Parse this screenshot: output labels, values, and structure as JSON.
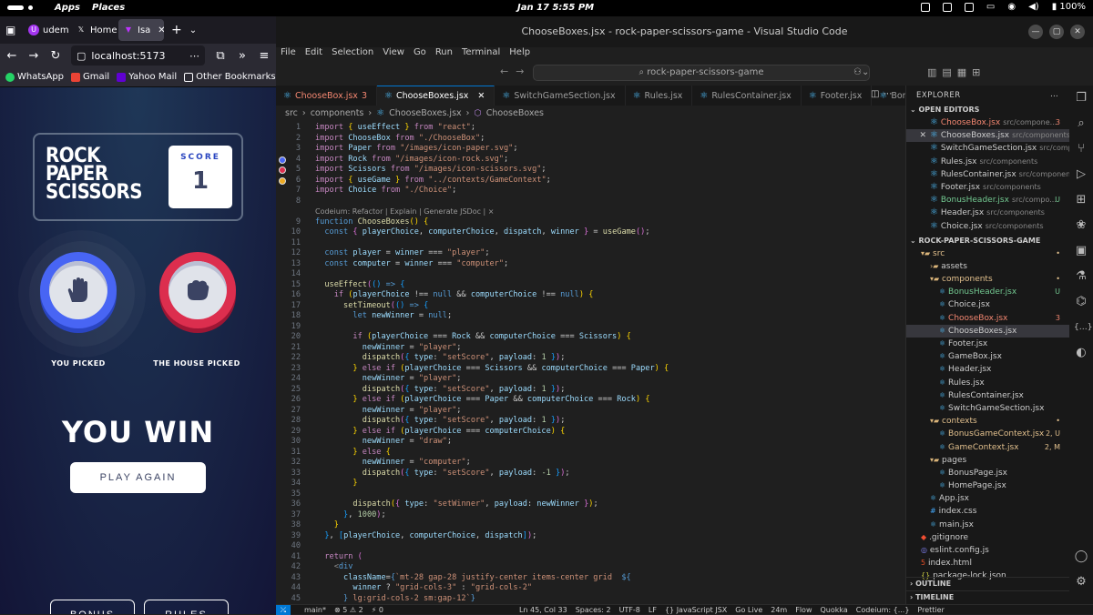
{
  "topbar": {
    "apps": "Apps",
    "places": "Places",
    "clock": "Jan 17  5:55 PM",
    "battery": "100%"
  },
  "browser": {
    "tabs": [
      {
        "label": "udem",
        "icon": "udemy-icon"
      },
      {
        "label": "Home",
        "icon": "x-icon"
      },
      {
        "label": "Isa",
        "icon": "vite-icon"
      }
    ],
    "url": "localhost:5173",
    "bookmarks": [
      "WhatsApp",
      "Gmail",
      "Yahoo Mail",
      "Other Bookmarks"
    ]
  },
  "game": {
    "title_l1": "ROCK",
    "title_l2": "PAPER",
    "title_l3": "SCISSORS",
    "score_label": "SCORE",
    "score_value": "1",
    "you_picked": "YOU PICKED",
    "house_picked": "THE HOUSE PICKED",
    "result": "YOU WIN",
    "play_again": "PLAY AGAIN",
    "bonus": "BONUS",
    "rules": "RULES",
    "colors": {
      "paper": "#4865f4",
      "rock": "#dc2e4e"
    }
  },
  "vscode": {
    "title": "ChooseBoxes.jsx - rock-paper-scissors-game - Visual Studio Code",
    "menu": [
      "File",
      "Edit",
      "Selection",
      "View",
      "Go",
      "Run",
      "Terminal",
      "Help"
    ],
    "search": "rock-paper-scissors-game",
    "tabs": [
      {
        "label": "ChooseBox.jsx",
        "badge": "3"
      },
      {
        "label": "ChooseBoxes.jsx",
        "badge": ""
      },
      {
        "label": "SwitchGameSection.jsx",
        "badge": ""
      },
      {
        "label": "Rules.jsx",
        "badge": ""
      },
      {
        "label": "RulesContainer.jsx",
        "badge": ""
      },
      {
        "label": "Footer.jsx",
        "badge": ""
      },
      {
        "label": "Bonus",
        "badge": ""
      }
    ],
    "breadcrumb": [
      "src",
      "components",
      "ChooseBoxes.jsx",
      "ChooseBoxes"
    ],
    "codelens": "Codeium: Refactor | Explain | Generate JSDoc | ×",
    "explorer": {
      "header": "EXPLORER",
      "open_editors_label": "OPEN EDITORS",
      "project_label": "ROCK-PAPER-SCISSORS-GAME",
      "outline": "OUTLINE",
      "timeline": "TIMELINE",
      "open_editors": [
        {
          "name": "ChooseBox.jsx",
          "path": "src/compone...",
          "status": "3",
          "cls": "err"
        },
        {
          "name": "ChooseBoxes.jsx",
          "path": "src/components",
          "status": "",
          "cls": ""
        },
        {
          "name": "SwitchGameSection.jsx",
          "path": "src/comp...",
          "status": "",
          "cls": ""
        },
        {
          "name": "Rules.jsx",
          "path": "src/components",
          "status": "",
          "cls": ""
        },
        {
          "name": "RulesContainer.jsx",
          "path": "src/components",
          "status": "",
          "cls": ""
        },
        {
          "name": "Footer.jsx",
          "path": "src/components",
          "status": "",
          "cls": ""
        },
        {
          "name": "BonusHeader.jsx",
          "path": "src/compo...",
          "status": "U",
          "cls": "unt"
        },
        {
          "name": "Header.jsx",
          "path": "src/components",
          "status": "",
          "cls": ""
        },
        {
          "name": "Choice.jsx",
          "path": "src/components",
          "status": "",
          "cls": ""
        }
      ],
      "tree": [
        {
          "name": "src",
          "indent": 1,
          "kind": "folder",
          "status": "•",
          "cls": "mod"
        },
        {
          "name": "assets",
          "indent": 2,
          "kind": "folder-closed",
          "status": "",
          "cls": ""
        },
        {
          "name": "components",
          "indent": 2,
          "kind": "folder",
          "status": "•",
          "cls": "mod"
        },
        {
          "name": "BonusHeader.jsx",
          "indent": 3,
          "kind": "react",
          "status": "U",
          "cls": "unt"
        },
        {
          "name": "Choice.jsx",
          "indent": 3,
          "kind": "react",
          "status": "",
          "cls": ""
        },
        {
          "name": "ChooseBox.jsx",
          "indent": 3,
          "kind": "react",
          "status": "3",
          "cls": "err"
        },
        {
          "name": "ChooseBoxes.jsx",
          "indent": 3,
          "kind": "react",
          "status": "",
          "cls": "",
          "sel": true
        },
        {
          "name": "Footer.jsx",
          "indent": 3,
          "kind": "react",
          "status": "",
          "cls": ""
        },
        {
          "name": "GameBox.jsx",
          "indent": 3,
          "kind": "react",
          "status": "",
          "cls": ""
        },
        {
          "name": "Header.jsx",
          "indent": 3,
          "kind": "react",
          "status": "",
          "cls": ""
        },
        {
          "name": "Rules.jsx",
          "indent": 3,
          "kind": "react",
          "status": "",
          "cls": ""
        },
        {
          "name": "RulesContainer.jsx",
          "indent": 3,
          "kind": "react",
          "status": "",
          "cls": ""
        },
        {
          "name": "SwitchGameSection.jsx",
          "indent": 3,
          "kind": "react",
          "status": "",
          "cls": ""
        },
        {
          "name": "contexts",
          "indent": 2,
          "kind": "folder",
          "status": "•",
          "cls": "mod"
        },
        {
          "name": "BonusGameContext.jsx",
          "indent": 3,
          "kind": "react",
          "status": "2, U",
          "cls": "mod"
        },
        {
          "name": "GameContext.jsx",
          "indent": 3,
          "kind": "react",
          "status": "2, M",
          "cls": "mod"
        },
        {
          "name": "pages",
          "indent": 2,
          "kind": "folder",
          "status": "",
          "cls": ""
        },
        {
          "name": "BonusPage.jsx",
          "indent": 3,
          "kind": "react",
          "status": "",
          "cls": ""
        },
        {
          "name": "HomePage.jsx",
          "indent": 3,
          "kind": "react",
          "status": "",
          "cls": ""
        },
        {
          "name": "App.jsx",
          "indent": 2,
          "kind": "react",
          "status": "",
          "cls": ""
        },
        {
          "name": "index.css",
          "indent": 2,
          "kind": "css",
          "status": "",
          "cls": ""
        },
        {
          "name": "main.jsx",
          "indent": 2,
          "kind": "react",
          "status": "",
          "cls": ""
        },
        {
          "name": ".gitignore",
          "indent": 1,
          "kind": "git",
          "status": "",
          "cls": ""
        },
        {
          "name": "eslint.config.js",
          "indent": 1,
          "kind": "eslint",
          "status": "",
          "cls": ""
        },
        {
          "name": "index.html",
          "indent": 1,
          "kind": "html",
          "status": "",
          "cls": ""
        },
        {
          "name": "package-lock.json",
          "indent": 1,
          "kind": "json",
          "status": "",
          "cls": ""
        }
      ]
    },
    "code": [
      {
        "n": "1",
        "h": "<span class='k'>import</span> <span class='y'>{</span> <span class='v'>useEffect</span> <span class='y'>}</span> <span class='k'>from</span> <span class='s'>\"react\"</span>;"
      },
      {
        "n": "2",
        "h": "<span class='k'>import</span> <span class='v'>ChooseBox</span> <span class='k'>from</span> <span class='s'>\"./ChooseBox\"</span>;"
      },
      {
        "n": "3",
        "h": "<span class='k'>import</span> <span class='v'>Paper</span> <span class='k'>from</span> <span class='s'>\"/images/icon-paper.svg\"</span>;"
      },
      {
        "n": "4",
        "h": "<span class='k'>import</span> <span class='v'>Rock</span> <span class='k'>from</span> <span class='s'>\"/images/icon-rock.svg\"</span>;"
      },
      {
        "n": "5",
        "h": "<span class='k'>import</span> <span class='v'>Scissors</span> <span class='k'>from</span> <span class='s'>\"/images/icon-scissors.svg\"</span>;"
      },
      {
        "n": "6",
        "h": "<span class='k'>import</span> <span class='y'>{</span> <span class='v'>useGame</span> <span class='y'>}</span> <span class='k'>from</span> <span class='s'>\"../contexts/GameContext\"</span>;"
      },
      {
        "n": "7",
        "h": "<span class='k'>import</span> <span class='v'>Choice</span> <span class='k'>from</span> <span class='s'>\"./Choice\"</span>;"
      },
      {
        "n": "8",
        "h": ""
      },
      {
        "n": "",
        "h": "<span class='lens'>Codeium: Refactor | Explain | Generate JSDoc | ×</span>"
      },
      {
        "n": "9",
        "h": "<span class='kb'>function</span> <span class='f'>ChooseBoxes</span><span class='y'>()</span> <span class='y'>{</span>"
      },
      {
        "n": "10",
        "h": "  <span class='kb'>const</span> <span class='p'>{</span> <span class='v'>playerChoice</span>, <span class='v'>computerChoice</span>, <span class='v'>dispatch</span>, <span class='v'>winner</span> <span class='p'>}</span> = <span class='f'>useGame</span><span class='p'>()</span>;"
      },
      {
        "n": "11",
        "h": ""
      },
      {
        "n": "12",
        "h": "  <span class='kb'>const</span> <span class='v'>player</span> = <span class='v'>winner</span> === <span class='s'>\"player\"</span>;"
      },
      {
        "n": "13",
        "h": "  <span class='kb'>const</span> <span class='v'>computer</span> = <span class='v'>winner</span> === <span class='s'>\"computer\"</span>;"
      },
      {
        "n": "14",
        "h": ""
      },
      {
        "n": "15",
        "h": "  <span class='f'>useEffect</span><span class='p'>(</span><span class='b'>()</span> <span class='kb'>=&gt;</span> <span class='b'>{</span>"
      },
      {
        "n": "16",
        "h": "    <span class='k'>if</span> <span class='y'>(</span><span class='v'>playerChoice</span> !== <span class='kb'>null</span> &amp;&amp; <span class='v'>computerChoice</span> !== <span class='kb'>null</span><span class='y'>)</span> <span class='y'>{</span>"
      },
      {
        "n": "17",
        "h": "      <span class='f'>setTimeout</span><span class='p'>(</span><span class='b'>()</span> <span class='kb'>=&gt;</span> <span class='b'>{</span>"
      },
      {
        "n": "18",
        "h": "        <span class='kb'>let</span> <span class='v'>newWinner</span> = <span class='kb'>null</span>;"
      },
      {
        "n": "19",
        "h": ""
      },
      {
        "n": "20",
        "h": "        <span class='k'>if</span> <span class='y'>(</span><span class='v'>playerChoice</span> === <span class='v'>Rock</span> &amp;&amp; <span class='v'>computerChoice</span> === <span class='v'>Scissors</span><span class='y'>)</span> <span class='y'>{</span>"
      },
      {
        "n": "21",
        "h": "          <span class='v'>newWinner</span> = <span class='s'>\"player\"</span>;"
      },
      {
        "n": "22",
        "h": "          <span class='f'>dispatch</span><span class='p'>(</span><span class='b'>{</span> <span class='v'>type</span>: <span class='s'>\"setScore\"</span>, <span class='v'>payload</span>: <span class='n'>1</span> <span class='b'>}</span><span class='p'>)</span>;"
      },
      {
        "n": "23",
        "h": "        <span class='y'>}</span> <span class='k'>else if</span> <span class='y'>(</span><span class='v'>playerChoice</span> === <span class='v'>Scissors</span> &amp;&amp; <span class='v'>computerChoice</span> === <span class='v'>Paper</span><span class='y'>)</span> <span class='y'>{</span>"
      },
      {
        "n": "24",
        "h": "          <span class='v'>newWinner</span> = <span class='s'>\"player\"</span>;"
      },
      {
        "n": "25",
        "h": "          <span class='f'>dispatch</span><span class='p'>(</span><span class='b'>{</span> <span class='v'>type</span>: <span class='s'>\"setScore\"</span>, <span class='v'>payload</span>: <span class='n'>1</span> <span class='b'>}</span><span class='p'>)</span>;"
      },
      {
        "n": "26",
        "h": "        <span class='y'>}</span> <span class='k'>else if</span> <span class='y'>(</span><span class='v'>playerChoice</span> === <span class='v'>Paper</span> &amp;&amp; <span class='v'>computerChoice</span> === <span class='v'>Rock</span><span class='y'>)</span> <span class='y'>{</span>"
      },
      {
        "n": "27",
        "h": "          <span class='v'>newWinner</span> = <span class='s'>\"player\"</span>;"
      },
      {
        "n": "28",
        "h": "          <span class='f'>dispatch</span><span class='p'>(</span><span class='b'>{</span> <span class='v'>type</span>: <span class='s'>\"setScore\"</span>, <span class='v'>payload</span>: <span class='n'>1</span> <span class='b'>}</span><span class='p'>)</span>;"
      },
      {
        "n": "29",
        "h": "        <span class='y'>}</span> <span class='k'>else if</span> <span class='y'>(</span><span class='v'>playerChoice</span> === <span class='v'>computerChoice</span><span class='y'>)</span> <span class='y'>{</span>"
      },
      {
        "n": "30",
        "h": "          <span class='v'>newWinner</span> = <span class='s'>\"draw\"</span>;"
      },
      {
        "n": "31",
        "h": "        <span class='y'>}</span> <span class='k'>else</span> <span class='y'>{</span>"
      },
      {
        "n": "32",
        "h": "          <span class='v'>newWinner</span> = <span class='s'>\"computer\"</span>;"
      },
      {
        "n": "33",
        "h": "          <span class='f'>dispatch</span><span class='p'>(</span><span class='b'>{</span> <span class='v'>type</span>: <span class='s'>\"setScore\"</span>, <span class='v'>payload</span>: <span class='n'>-1</span> <span class='b'>}</span><span class='p'>)</span>;"
      },
      {
        "n": "34",
        "h": "        <span class='y'>}</span>"
      },
      {
        "n": "35",
        "h": ""
      },
      {
        "n": "36",
        "h": "        <span class='f'>dispatch</span><span class='y'>(</span><span class='p'>{</span> <span class='v'>type</span>: <span class='s'>\"setWinner\"</span>, <span class='v'>payload</span>: <span class='v'>newWinner</span> <span class='p'>}</span><span class='y'>)</span>;"
      },
      {
        "n": "37",
        "h": "      <span class='b'>}</span>, <span class='n'>1000</span><span class='p'>)</span>;"
      },
      {
        "n": "38",
        "h": "    <span class='y'>}</span>"
      },
      {
        "n": "39",
        "h": "  <span class='b'>}</span>, <span class='b'>[</span><span class='v'>playerChoice</span>, <span class='v'>computerChoice</span>, <span class='v'>dispatch</span><span class='b'>]</span><span class='p'>)</span>;"
      },
      {
        "n": "40",
        "h": ""
      },
      {
        "n": "41",
        "h": "  <span class='k'>return</span> <span class='p'>(</span>"
      },
      {
        "n": "42",
        "h": "    <span class='g'>&lt;</span><span class='kb'>div</span>"
      },
      {
        "n": "43",
        "h": "      <span class='v'>className</span>=<span class='kb'>{</span><span class='s'>`mt-28 gap-28 justify-center items-center grid  </span><span class='kb'>${</span>"
      },
      {
        "n": "44",
        "h": "        <span class='v'>winner</span> ? <span class='s'>\"grid-cols-3\"</span> : <span class='s'>\"grid-cols-2\"</span>"
      },
      {
        "n": "45",
        "h": "      <span class='kb'>}</span><span class='s'> lg:grid-cols-2 sm:gap-12`</span><span class='kb'>}</span>"
      }
    ],
    "statusbar": [
      "main*",
      "⊗ 5 ⚠ 2",
      "⚡ 0",
      "Ln 45, Col 33",
      "Spaces: 2",
      "UTF-8",
      "LF",
      "{} JavaScript JSX",
      "Go Live",
      "24m",
      "Flow",
      "Quokka",
      "Codeium: {...}",
      "Prettier"
    ]
  }
}
